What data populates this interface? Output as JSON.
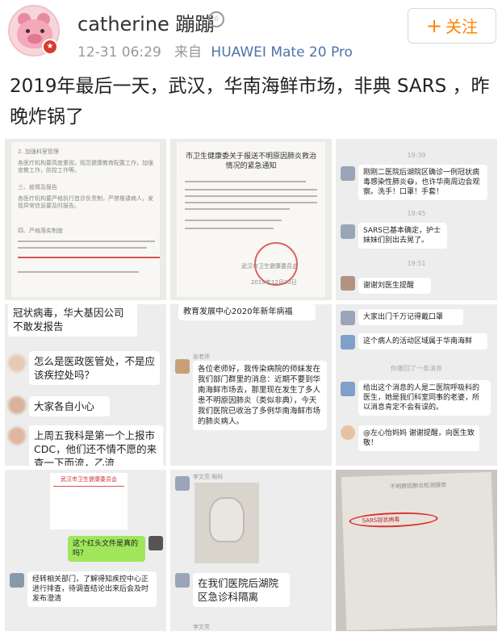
{
  "header": {
    "username": "catherine 蹦蹦",
    "timestamp": "12-31 06:29",
    "source_prefix": "来自",
    "device": "HUAWEI Mate 20 Pro",
    "follow_label": "关注",
    "follow_plus": "+"
  },
  "post": {
    "text": "2019年最后一天，武汉，华南海鲜市场，非典 SARS ，昨晚炸锅了"
  },
  "images": [
    {
      "lines": [
        "2. 加强科室管理",
        "各医疗机构要高度重视，规范健康教育配置工作，加强宣教工作，防控工作等。",
        "三、疫情及报告",
        "各医疗机构要严格执行首诊负责制，严禁推诿病人，发现异常信息要及时报告。",
        "四、严格落实制度"
      ]
    },
    {
      "title": "市卫生健康委关于报送不明原因肺炎救治情况的紧急通知",
      "org": "武汉市卫生健康委员会",
      "date": "2019年12月30日"
    },
    {
      "time1": "19:39",
      "msg1": "刚刚二医院后湖院区确诊一例冠状病毒感染性肺炎😷，也许华南周边会观察。洗手！口罩！手套！",
      "time2": "19:45",
      "msg2": "SARS已基本确定，护士妹妹们别出去晃了。",
      "time3": "19:51",
      "msg3": "谢谢刘医生提醒"
    },
    {
      "msg1": "冠状病毒，华大基因公司不敢发报告",
      "msg2": "怎么是医政医管处，不是应该疾控处吗？",
      "msg3": "大家各自小心",
      "msg4": "上周五我科是第一个上报市CDC，他们还不情不愿的来查一下而流，乙流"
    },
    {
      "top": "教育发展中心2020年新年病福",
      "msg": "各位老师好，我传染病院的师妹发在我们部门群里的消息：近期不要到华南海鲜市场去，那里现在发生了多人患不明原因肺炎（类似非典），今天我们医院已收治了多例华南海鲜市场的肺炎病人。",
      "name": "张老师"
    },
    {
      "msg1": "大家出门千万记得戴口罩",
      "msg2": "这个病人的活动区域属于华南海鲜",
      "notice": "你撤回了一条消息",
      "msg3": "给出这个消息的人是二医院呼吸科的医生，她是我们科室同事的老婆，所以消息肯定不会有误的。",
      "msg4": "@左心怡妈妈 谢谢提醒，向医生致敬！"
    },
    {
      "doc_title": "武汉市卫生健康委员会",
      "msg1": "这个红头文件是真的吗？",
      "msg2": "经转相关部门，了解得知疾控中心正进行排查，待调查结论出来后会及时发布澄清"
    },
    {
      "name": "李文亮 眼科",
      "msg": "在我们医院后湖院区急诊科隔离",
      "name2": "李文亮"
    },
    {
      "title": "不明原因肺炎检测报告",
      "highlight": "SARS冠状病毒"
    }
  ],
  "colors": {
    "accent_follow": "#ff8200",
    "device_link": "#4f72a8",
    "wechat_green": "#9fe65b",
    "red_seal": "#d63c3c"
  }
}
